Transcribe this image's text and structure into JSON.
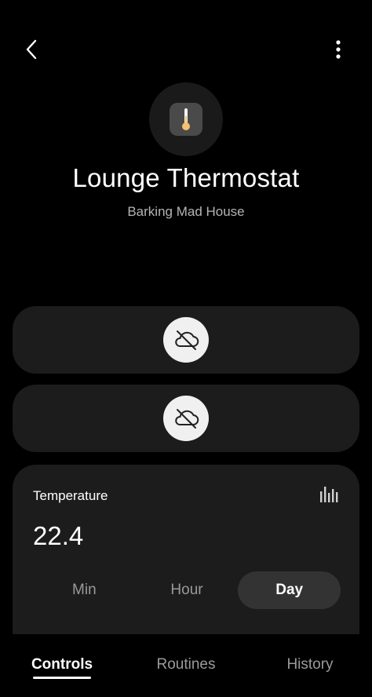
{
  "header": {
    "back_icon": "chevron-left-icon",
    "more_icon": "more-vertical-icon"
  },
  "device": {
    "icon": "thermometer-icon",
    "name": "Lounge Thermostat",
    "location": "Barking Mad House"
  },
  "controls": [
    {
      "icon": "cloud-off-icon",
      "status": "offline"
    },
    {
      "icon": "cloud-off-icon",
      "status": "offline"
    }
  ],
  "temperature": {
    "label": "Temperature",
    "value": "22.4",
    "chart_icon": "bar-chart-icon",
    "ranges": [
      {
        "label": "Min",
        "active": false
      },
      {
        "label": "Hour",
        "active": false
      },
      {
        "label": "Day",
        "active": true
      }
    ]
  },
  "nav": {
    "tabs": [
      {
        "label": "Controls",
        "active": true
      },
      {
        "label": "Routines",
        "active": false
      },
      {
        "label": "History",
        "active": false
      }
    ]
  },
  "colors": {
    "background": "#000000",
    "card": "#1c1c1c",
    "active_pill": "#333333",
    "muted_text": "#9a9a9a",
    "thermometer_bulb": "#f5c070"
  }
}
